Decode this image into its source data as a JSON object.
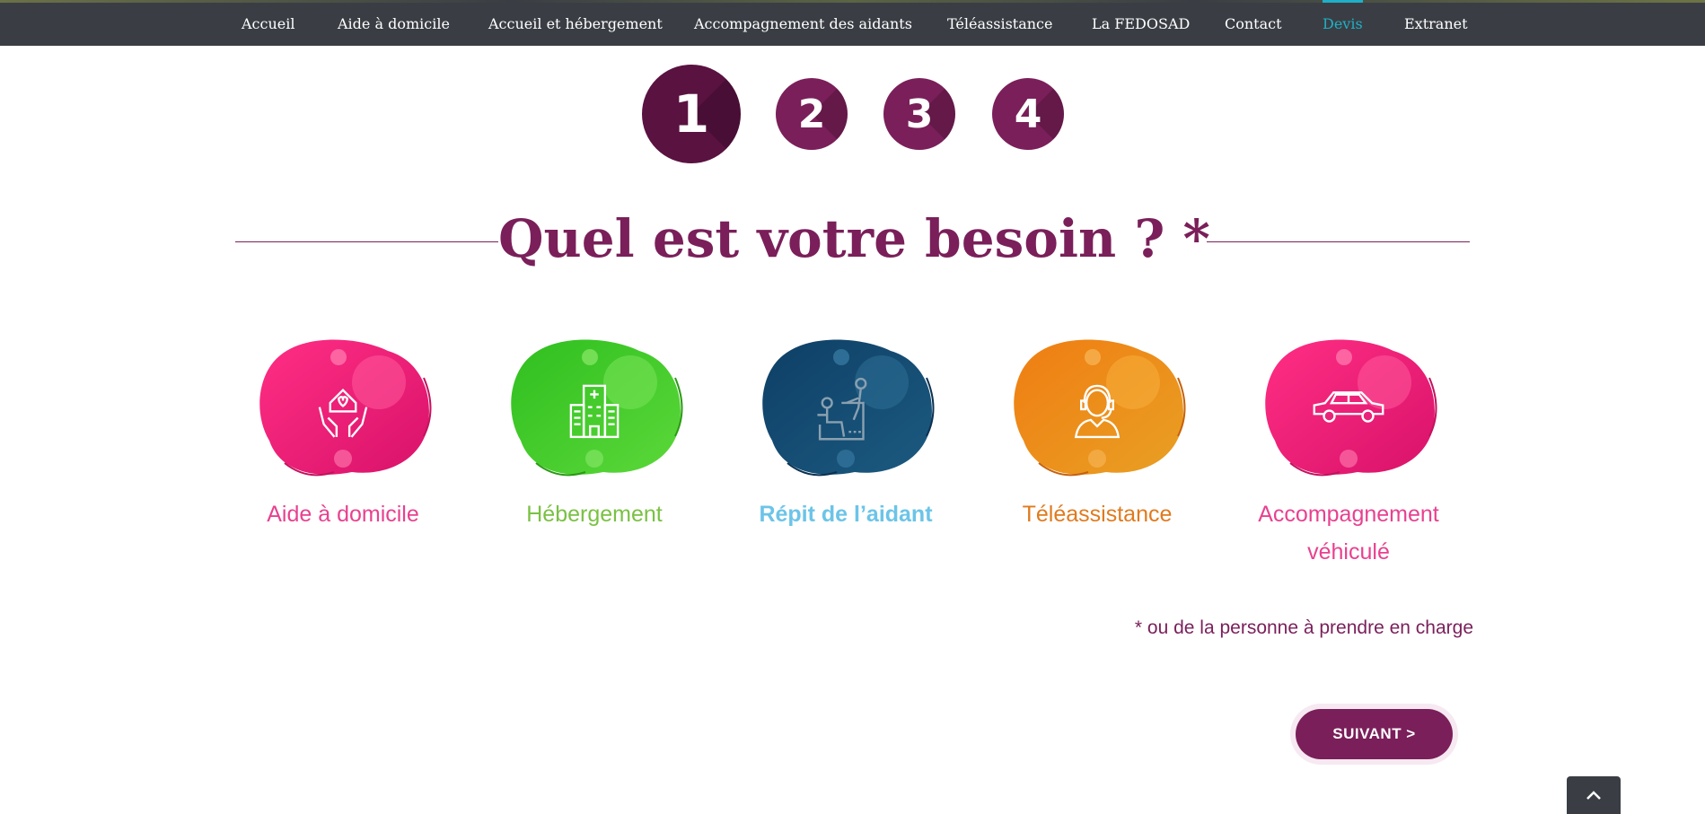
{
  "nav": {
    "items": [
      {
        "label": "Accueil"
      },
      {
        "label": "Aide à domicile"
      },
      {
        "label": "Accueil et hébergement"
      },
      {
        "label": "Accompagnement des aidants"
      },
      {
        "label": "Téléassistance"
      },
      {
        "label": "La FEDOSAD"
      },
      {
        "label": "Contact"
      },
      {
        "label": "Devis",
        "active": true
      },
      {
        "label": "Extranet"
      }
    ]
  },
  "steps": [
    {
      "label": "1",
      "current": true
    },
    {
      "label": "2"
    },
    {
      "label": "3"
    },
    {
      "label": "4"
    }
  ],
  "question": {
    "title": "Quel est votre besoin ? *"
  },
  "options": [
    {
      "label": "Aide à domicile",
      "color": "#e8418f",
      "icon": "home-heart-hands-icon"
    },
    {
      "label": "Hébergement",
      "color": "#7ac143",
      "icon": "hospital-building-icon"
    },
    {
      "label": "Répit de l’aidant",
      "color": "#6cc4e8",
      "icon": "caregiver-wheelchair-icon"
    },
    {
      "label": "Téléassistance",
      "color": "#e07a1e",
      "icon": "operator-headset-icon"
    },
    {
      "label": "Accompagnement véhiculé",
      "color": "#e8418f",
      "icon": "car-icon"
    }
  ],
  "note": "* ou de la personne à prendre en charge",
  "next_button": "SUIVANT >",
  "colors": {
    "brand": "#7a1f5a",
    "nav_bg": "#3a3e44",
    "nav_active": "#1fb0c8"
  },
  "icons": {
    "back_to_top": "chevron-up-icon"
  }
}
